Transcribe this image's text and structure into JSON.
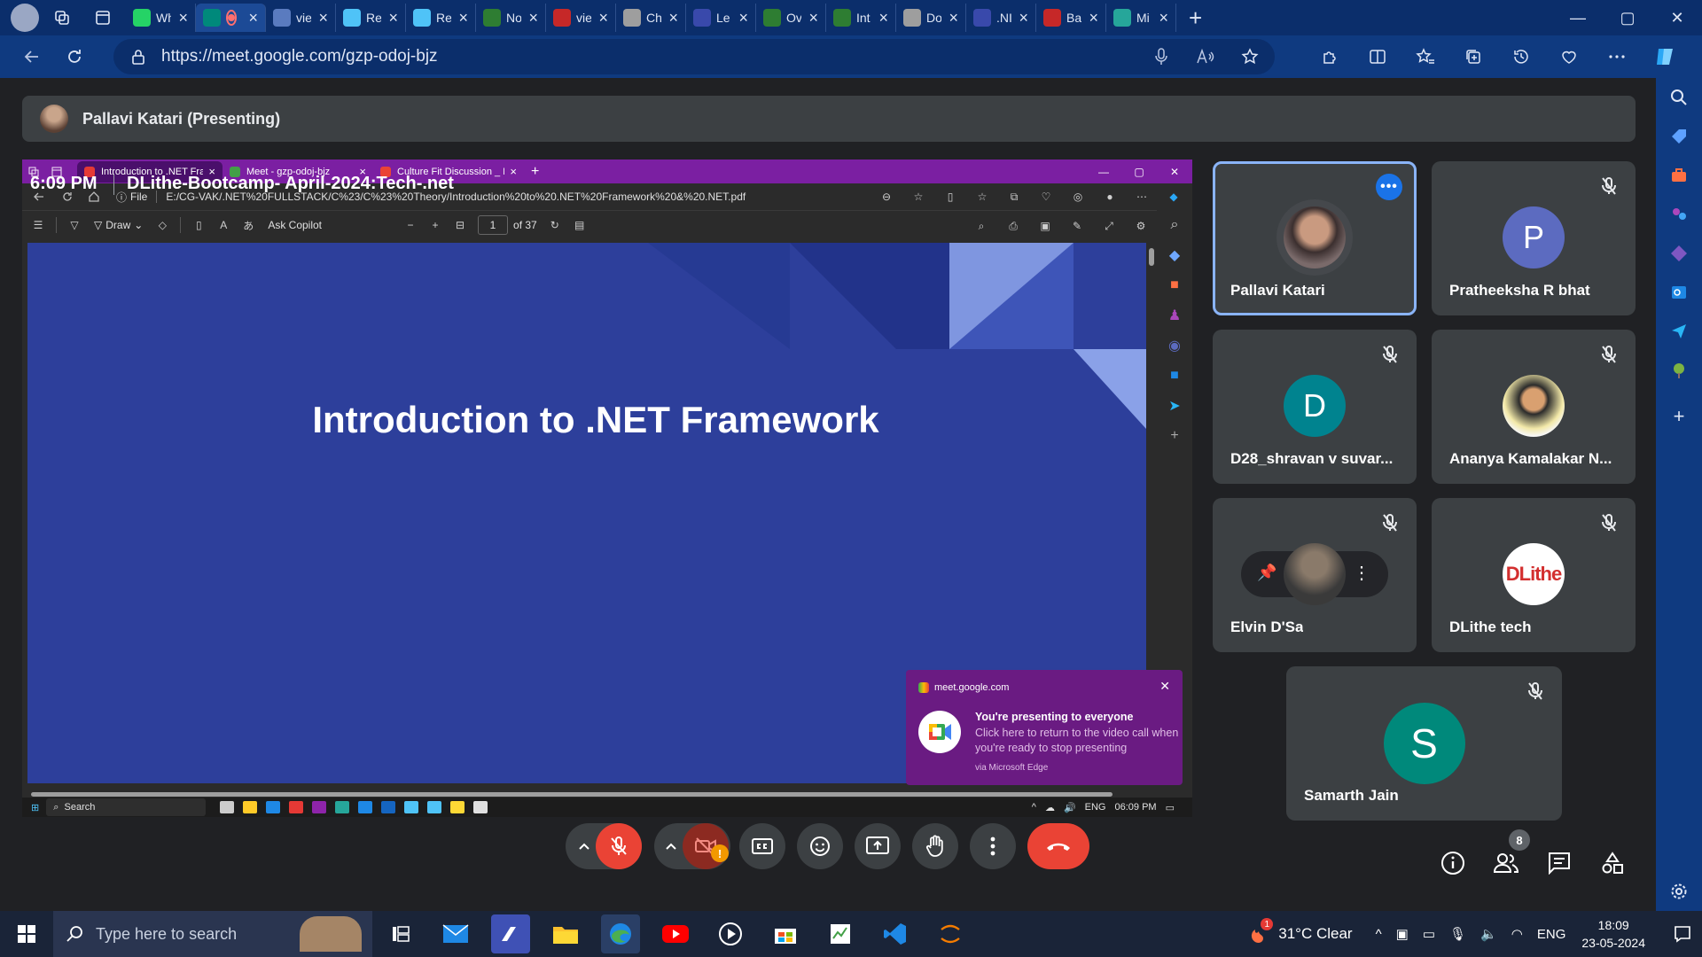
{
  "browser": {
    "tabs": [
      {
        "label": "Wh",
        "color": "#25d366"
      },
      {
        "label": "",
        "color": "#00897b",
        "active": true,
        "recording": true
      },
      {
        "label": "vie",
        "color": "#5a7bbf"
      },
      {
        "label": "Re",
        "color": "#4fc3f7"
      },
      {
        "label": "Re",
        "color": "#4fc3f7"
      },
      {
        "label": "No",
        "color": "#2e7d32"
      },
      {
        "label": "vie",
        "color": "#c62828"
      },
      {
        "label": "Ch",
        "color": "#9e9e9e"
      },
      {
        "label": "Le",
        "color": "#3949ab"
      },
      {
        "label": "Ov",
        "color": "#2e7d32"
      },
      {
        "label": "Int",
        "color": "#2e7d32"
      },
      {
        "label": "Do",
        "color": "#9e9e9e"
      },
      {
        "label": ".NI",
        "color": "#3949ab"
      },
      {
        "label": "Ba",
        "color": "#c62828"
      },
      {
        "label": "Mi",
        "color": "#26a69a"
      }
    ],
    "url": "https://meet.google.com/gzp-odoj-bjz"
  },
  "meet": {
    "presenter_label": "Pallavi Katari (Presenting)",
    "time": "6:09 PM",
    "meeting_name": "DLithe-Bootcamp- April-2024:Tech-.net",
    "people_count": "8",
    "participants": [
      {
        "name": "Pallavi Katari",
        "initial": "",
        "color": "#3c4043",
        "photo": true,
        "speaking": true
      },
      {
        "name": "Pratheeksha R bhat",
        "initial": "P",
        "color": "#5c6bc0",
        "muted": true
      },
      {
        "name": "D28_shravan v suvar...",
        "initial": "D",
        "color": "#00838f",
        "muted": true
      },
      {
        "name": "Ananya Kamalakar N...",
        "initial": "",
        "color": "#f5f5f5",
        "photo": true,
        "muted": true
      },
      {
        "name": "Elvin D'Sa",
        "initial": "",
        "color": "#555",
        "photo": true,
        "muted": true,
        "pinbar": true
      },
      {
        "name": "DLithe tech",
        "initial": "DLithe",
        "color": "#ffffff",
        "logo": true,
        "muted": true
      },
      {
        "name": "Samarth Jain",
        "initial": "S",
        "color": "#00897b",
        "muted": true
      }
    ]
  },
  "shared": {
    "tabs": [
      {
        "label": "Introduction to .NET Framework",
        "color": "#e53935",
        "active": true
      },
      {
        "label": "Meet - gzp-odoj-bjz",
        "color": "#43a047"
      },
      {
        "label": "Culture Fit Discussion _ Dot Net",
        "color": "#ea4335"
      }
    ],
    "file_label": "File",
    "url": "E:/CG-VAK/.NET%20FULLSTACK/C%23/C%23%20Theory/Introduction%20to%20.NET%20Framework%20&%20.NET.pdf",
    "toolbar": {
      "draw": "Draw",
      "ask": "Ask Copilot",
      "page": "1",
      "of": "of 37"
    },
    "slide_title": "Introduction to .NET Framework",
    "taskbar": {
      "search": "Search",
      "lang": "ENG",
      "time": "06:09 PM"
    },
    "notification": {
      "source": "meet.google.com",
      "heading": "You're presenting to everyone",
      "body": "Click here to return to the video call when you're ready to stop presenting",
      "via": "via Microsoft Edge"
    }
  },
  "taskbar": {
    "search_placeholder": "Type here to search",
    "weather": "31°C  Clear",
    "weather_badge": "1",
    "lang": "ENG",
    "time": "18:09",
    "date": "23-05-2024"
  },
  "colors": {
    "accent": "#1a73e8",
    "end_call": "#ea4335",
    "slide_bg": "#2d3f9b"
  }
}
